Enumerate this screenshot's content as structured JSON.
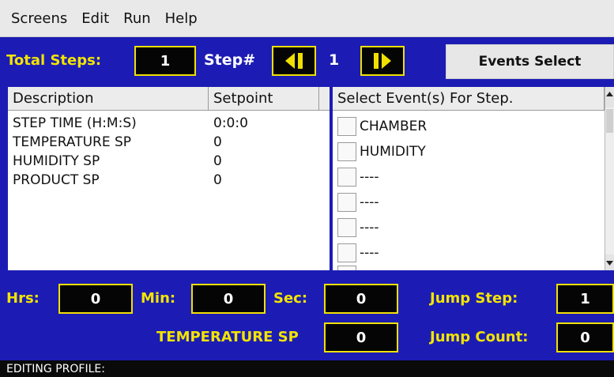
{
  "menu": {
    "items": [
      "Screens",
      "Edit",
      "Run",
      "Help"
    ]
  },
  "toolbar": {
    "total_steps_label": "Total Steps:",
    "total_steps_value": "1",
    "step_label": "Step#",
    "step_value": "1",
    "prev_icon": "arrow-left-icon",
    "next_icon": "arrow-right-icon",
    "events_select_label": "Events Select"
  },
  "param_table": {
    "headers": [
      "Description",
      "Setpoint"
    ],
    "rows": [
      {
        "description": "STEP TIME (H:M:S)",
        "setpoint": "0:0:0"
      },
      {
        "description": "TEMPERATURE SP",
        "setpoint": "0"
      },
      {
        "description": "HUMIDITY SP",
        "setpoint": "0"
      },
      {
        "description": "PRODUCT SP",
        "setpoint": "0"
      }
    ]
  },
  "events": {
    "header": "Select Event(s) For Step.",
    "items": [
      "CHAMBER",
      "HUMIDITY",
      "----",
      "----",
      "----",
      "----"
    ]
  },
  "time_fields": {
    "hrs_label": "Hrs:",
    "hrs_value": "0",
    "min_label": "Min:",
    "min_value": "0",
    "sec_label": "Sec:",
    "sec_value": "0"
  },
  "jump": {
    "step_label": "Jump Step:",
    "step_value": "1",
    "count_label": "Jump Count:",
    "count_value": "0"
  },
  "setpoint_field": {
    "label": "TEMPERATURE SP",
    "value": "0"
  },
  "status": {
    "text": "EDITING PROFILE:"
  },
  "colors": {
    "background": "#1c1cb4",
    "label_yellow": "#f2e400",
    "box_black": "#050505"
  }
}
